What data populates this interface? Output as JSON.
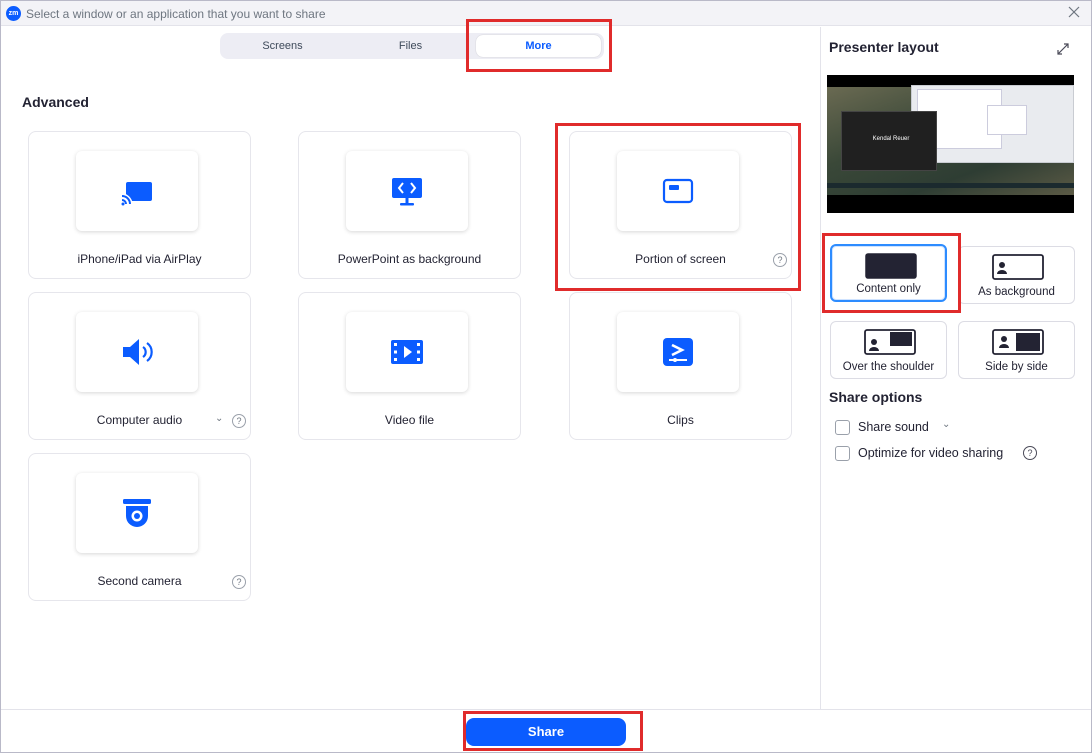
{
  "window": {
    "title": "Select a window or an application that you want to share",
    "logo_text": "zm"
  },
  "tabs": [
    {
      "label": "Screens",
      "selected": false
    },
    {
      "label": "Files",
      "selected": false
    },
    {
      "label": "More",
      "selected": true
    }
  ],
  "section_title": "Advanced",
  "options": [
    {
      "label": "iPhone/iPad via AirPlay",
      "icon": "airplay-icon"
    },
    {
      "label": "PowerPoint as background",
      "icon": "powerpoint-background-icon"
    },
    {
      "label": "Portion of screen",
      "icon": "portion-of-screen-icon",
      "help": "?"
    },
    {
      "label": "Computer audio",
      "icon": "speaker-icon",
      "help": "?",
      "chevron": "⌄"
    },
    {
      "label": "Video file",
      "icon": "film-icon"
    },
    {
      "label": "Clips",
      "icon": "clips-icon"
    },
    {
      "label": "Second camera",
      "icon": "webcam-icon",
      "help": "?"
    }
  ],
  "right_panel": {
    "presenter_title": "Presenter layout",
    "preview_name": "Kendal Reuer",
    "layouts": [
      {
        "label": "Content only",
        "selected": true
      },
      {
        "label": "As background",
        "selected": false
      },
      {
        "label": "Over the shoulder",
        "selected": false
      },
      {
        "label": "Side by side",
        "selected": false
      }
    ],
    "share_options_title": "Share options",
    "share_options": [
      {
        "label": "Share sound",
        "checked": false,
        "chevron": "⌄"
      },
      {
        "label": "Optimize for video sharing",
        "checked": false,
        "help": "?"
      }
    ]
  },
  "footer": {
    "share_label": "Share"
  },
  "colors": {
    "accent": "#0b5cff",
    "selected_border": "#2d8cff",
    "annotation_red": "#e02b2b"
  }
}
